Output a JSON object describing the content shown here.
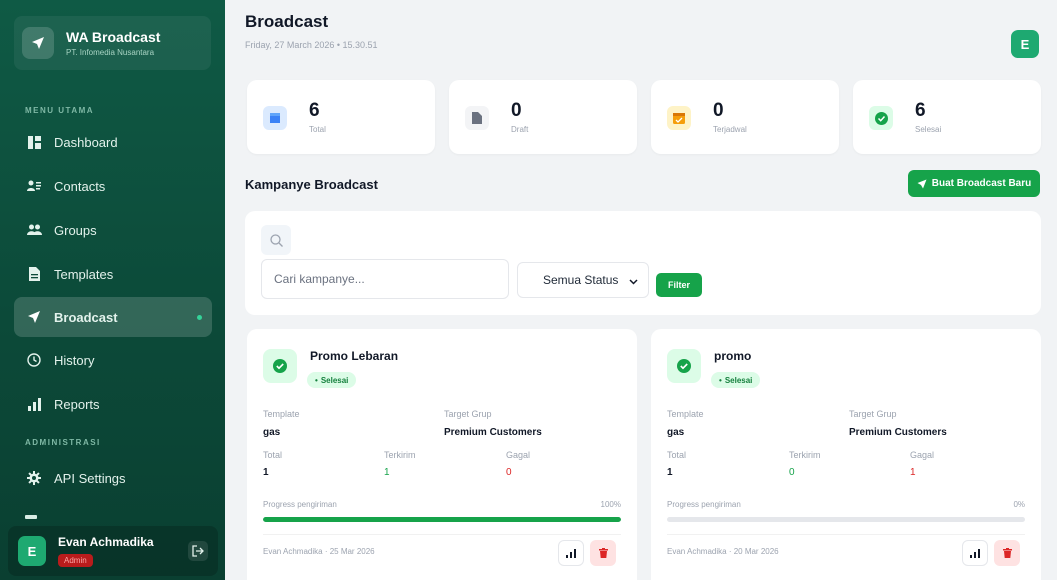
{
  "brand": {
    "title": "WA Broadcast",
    "subtitle": "PT. Infomedia Nusantara"
  },
  "sidebar": {
    "section_main": "MENU UTAMA",
    "section_admin": "ADMINISTRASI",
    "items": [
      {
        "label": "Dashboard",
        "icon": "dashboard-icon"
      },
      {
        "label": "Contacts",
        "icon": "contacts-icon"
      },
      {
        "label": "Groups",
        "icon": "groups-icon"
      },
      {
        "label": "Templates",
        "icon": "templates-icon"
      },
      {
        "label": "Broadcast",
        "icon": "send-icon",
        "active": true
      },
      {
        "label": "History",
        "icon": "clock-icon"
      },
      {
        "label": "Reports",
        "icon": "bar-chart-icon"
      },
      {
        "label": "API Settings",
        "icon": "gear-icon"
      }
    ]
  },
  "user": {
    "initial": "E",
    "name": "Evan Achmadika",
    "role": "Admin"
  },
  "header": {
    "title": "Broadcast",
    "date": "Friday, 27 March 2026 • 15.30.51",
    "avatar_initial": "E"
  },
  "stats": [
    {
      "value": "6",
      "label": "Total",
      "color": "#3b82f6"
    },
    {
      "value": "0",
      "label": "Draft",
      "color": "#6b7280"
    },
    {
      "value": "0",
      "label": "Terjadwal",
      "color": "#f59e0b"
    },
    {
      "value": "6",
      "label": "Selesai",
      "color": "#16a34a"
    }
  ],
  "section": {
    "title": "Kampanye Broadcast",
    "new_button": "Buat Broadcast Baru"
  },
  "filter": {
    "search_placeholder": "Cari kampanye...",
    "status_selected": "Semua Status",
    "filter_button": "Filter"
  },
  "labels": {
    "template": "Template",
    "target": "Target Grup",
    "total": "Total",
    "sent": "Terkirim",
    "failed": "Gagal",
    "progress": "Progress pengiriman"
  },
  "campaigns": [
    {
      "name": "Promo Lebaran",
      "status": "Selesai",
      "template": "gas",
      "target": "Premium Customers",
      "total": "1",
      "sent": "1",
      "failed": "0",
      "progress_pct": "100%",
      "progress": 1.0,
      "meta": "Evan Achmadika · 25 Mar 2026"
    },
    {
      "name": "promo",
      "status": "Selesai",
      "template": "gas",
      "target": "Premium Customers",
      "total": "1",
      "sent": "0",
      "failed": "1",
      "progress_pct": "0%",
      "progress": 0.0,
      "meta": "Evan Achmadika · 20 Mar 2026"
    }
  ],
  "colors": {
    "sidebar": "#0f5a45",
    "accent": "#16a34a",
    "danger": "#dc2626"
  }
}
